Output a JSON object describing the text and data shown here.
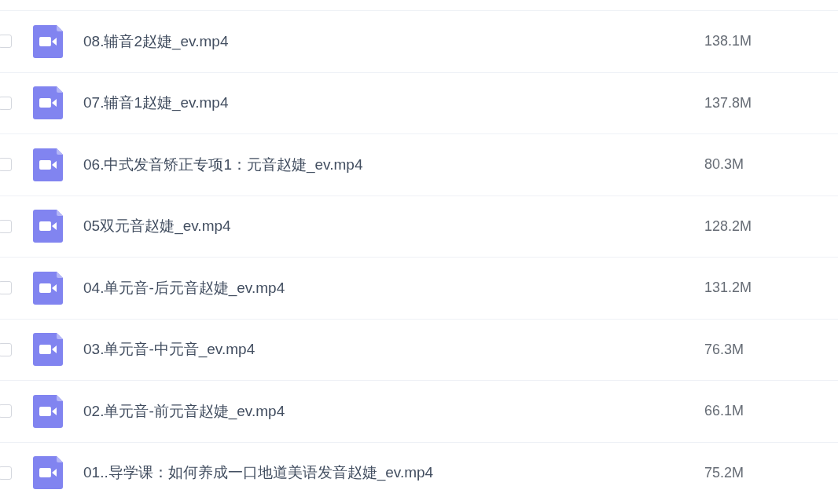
{
  "files": [
    {
      "name": "08.辅音2赵婕_ev.mp4",
      "size": "138.1M",
      "checked": false
    },
    {
      "name": "07.辅音1赵婕_ev.mp4",
      "size": "137.8M",
      "checked": false
    },
    {
      "name": "06.中式发音矫正专项1：元音赵婕_ev.mp4",
      "size": "80.3M",
      "checked": false
    },
    {
      "name": "05双元音赵婕_ev.mp4",
      "size": "128.2M",
      "checked": false
    },
    {
      "name": "04.单元音-后元音赵婕_ev.mp4",
      "size": "131.2M",
      "checked": false
    },
    {
      "name": "03.单元音-中元音_ev.mp4",
      "size": "76.3M",
      "checked": false
    },
    {
      "name": "02.单元音-前元音赵婕_ev.mp4",
      "size": "66.1M",
      "checked": false
    },
    {
      "name": "01..导学课：如何养成一口地道美语发音赵婕_ev.mp4",
      "size": "75.2M",
      "checked": false
    }
  ]
}
